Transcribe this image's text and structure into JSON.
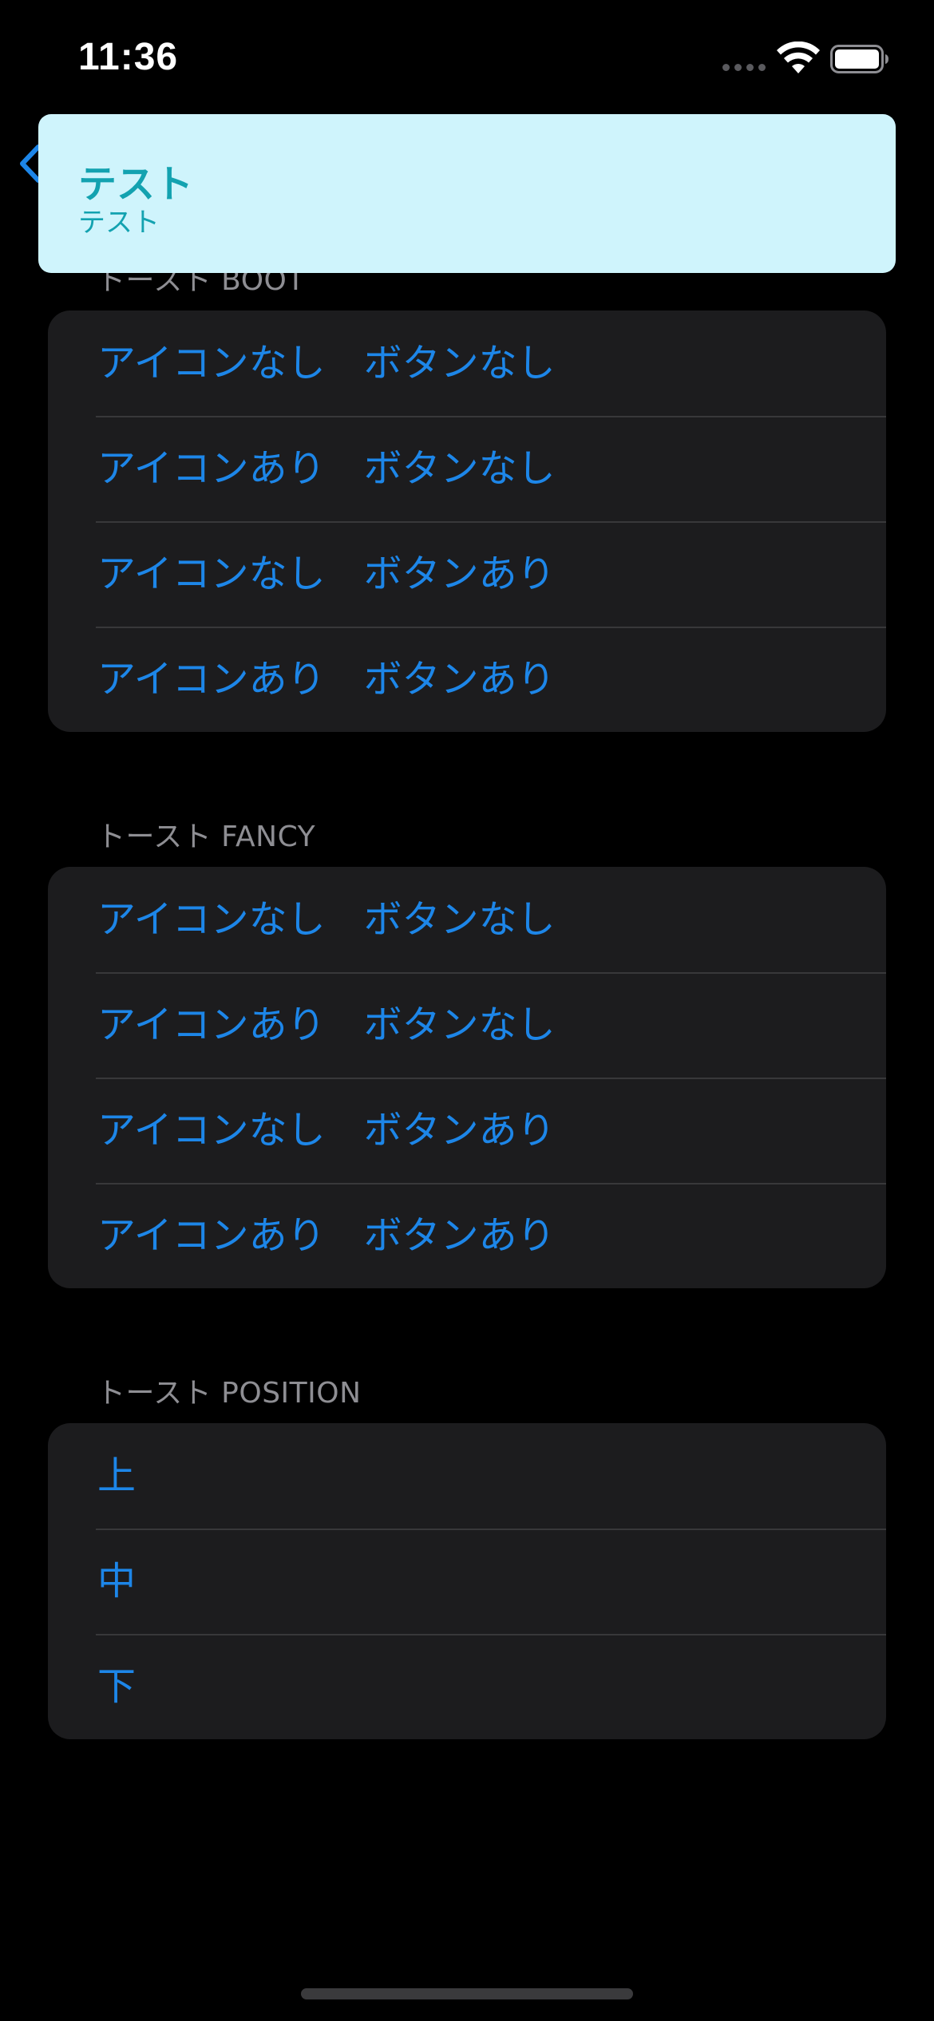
{
  "status_bar": {
    "time": "11:36",
    "signal_icon": "cellular-no-service-dots",
    "wifi_icon": "wifi-icon",
    "battery_icon": "battery-full-icon"
  },
  "nav": {
    "back_icon": "chevron-left-icon"
  },
  "toast": {
    "title": "テスト",
    "subtitle": "テスト",
    "background_color": "#cff4fc",
    "text_color": "#13a2b0"
  },
  "sections": [
    {
      "header": "トースト BOOT",
      "items": [
        "アイコンなし　ボタンなし",
        "アイコンあり　ボタンなし",
        "アイコンなし　ボタンあり",
        "アイコンあり　ボタンあり"
      ]
    },
    {
      "header": "トースト FANCY",
      "items": [
        "アイコンなし　ボタンなし",
        "アイコンあり　ボタンなし",
        "アイコンなし　ボタンあり",
        "アイコンあり　ボタンあり"
      ]
    },
    {
      "header": "トースト POSITION",
      "items": [
        "上",
        "中",
        "下"
      ]
    }
  ],
  "colors": {
    "background": "#000000",
    "group_background": "#1c1c1e",
    "link": "#1d86e8",
    "section_header": "#8e8e93",
    "separator": "#38383a"
  }
}
